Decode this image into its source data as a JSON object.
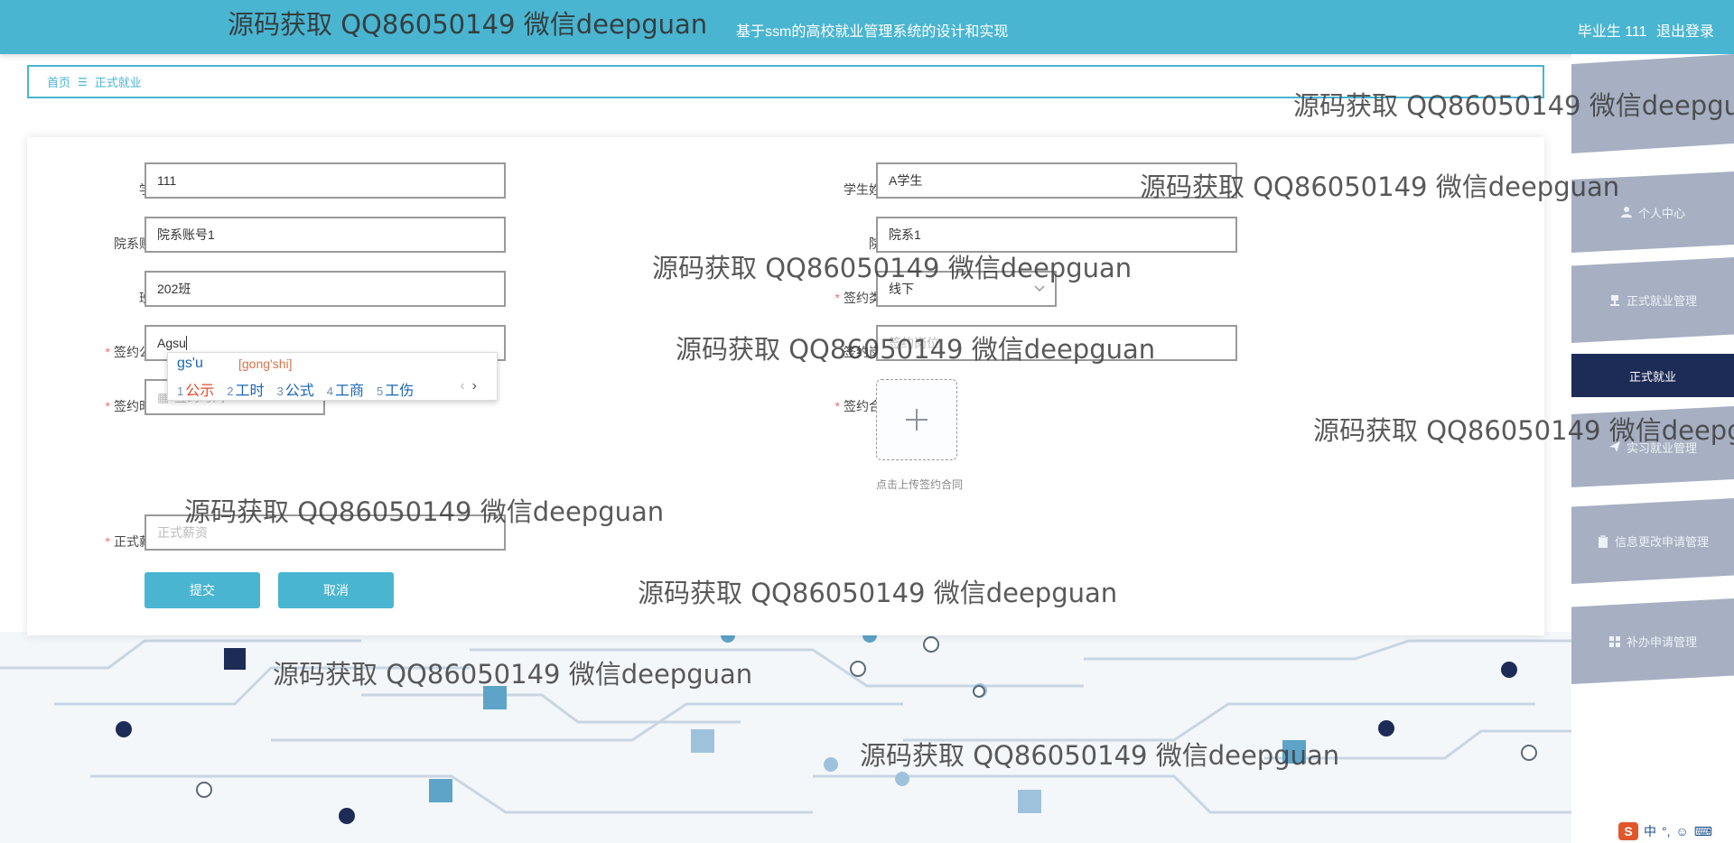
{
  "header": {
    "title": "基于ssm的高校就业管理系统的设计和实现",
    "user_label": "毕业生 111",
    "logout": "退出登录"
  },
  "breadcrumb": {
    "home": "首页",
    "current": "正式就业"
  },
  "form": {
    "student_no": {
      "label": "学号",
      "value": "111"
    },
    "student_name": {
      "label": "学生姓名",
      "value": "A学生"
    },
    "dept_account": {
      "label": "院系账号",
      "value": "院系账号1"
    },
    "dept": {
      "label": "院系",
      "value": "院系1"
    },
    "class": {
      "label": "班级",
      "value": "202班"
    },
    "sign_type": {
      "label": "签约类型",
      "value": "线下"
    },
    "company": {
      "label": "签约公司",
      "value": "Agsu"
    },
    "position": {
      "label": "签约岗位",
      "placeholder": "签约岗位"
    },
    "sign_time": {
      "label": "签约时间",
      "placeholder": "签约时间"
    },
    "contract": {
      "label": "签约合同",
      "hint": "点击上传签约合同"
    },
    "salary": {
      "label": "正式薪资",
      "placeholder": "正式薪资"
    },
    "submit": "提交",
    "cancel": "取消"
  },
  "ime": {
    "composition": "gs'u",
    "pinyin": "[gong'shi]",
    "candidates": [
      {
        "num": "1",
        "text": "公示"
      },
      {
        "num": "2",
        "text": "工时"
      },
      {
        "num": "3",
        "text": "公式"
      },
      {
        "num": "4",
        "text": "工商"
      },
      {
        "num": "5",
        "text": "工伤"
      }
    ],
    "prev": "‹",
    "next": "›"
  },
  "sidebar": {
    "items": [
      {
        "label": "个人中心",
        "icon": "user-icon"
      },
      {
        "label": "正式就业管理",
        "icon": "stamp-icon"
      },
      {
        "label": "正式就业",
        "icon": ""
      },
      {
        "label": "实习就业管理",
        "icon": "send-icon"
      },
      {
        "label": "信息更改申请管理",
        "icon": "clipboard-icon"
      },
      {
        "label": "补办申请管理",
        "icon": "grid-icon"
      }
    ]
  },
  "tray": {
    "ime_mode": "中",
    "punct": "°,"
  },
  "watermark": "源码获取 QQ86050149 微信deepguan",
  "colors": {
    "accent": "#4ab5d0",
    "sidebar_active": "#1d2b57",
    "sidebar_item": "#a6b0c2",
    "required": "#f56c6c"
  }
}
